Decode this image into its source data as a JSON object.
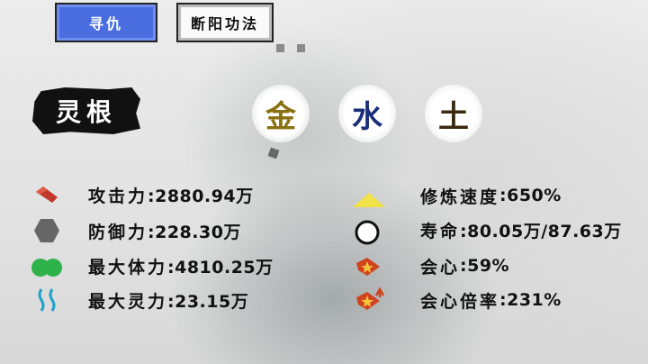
{
  "tabs": {
    "active_label": "寻仇",
    "inactive_label": "断阳功法"
  },
  "spirit_root": {
    "title": "灵根",
    "elements": [
      {
        "char": "金",
        "color": "#8a7010"
      },
      {
        "char": "水",
        "color": "#1a2e7a"
      },
      {
        "char": "土",
        "color": "#3a2a10"
      }
    ]
  },
  "stats_left": [
    {
      "icon": "red-gem-icon",
      "label": "攻击力",
      "value": ":2880.94万"
    },
    {
      "icon": "gray-shield-icon",
      "label": "防御力",
      "value": ":228.30万"
    },
    {
      "icon": "green-heart-icon",
      "label": "最大体力",
      "value": ":4810.25万"
    },
    {
      "icon": "blue-spirit-wave-icon",
      "label": "最大灵力",
      "value": ":23.15万"
    }
  ],
  "stats_right": [
    {
      "icon": "yellow-triangle-icon",
      "label": "修炼速度",
      "value": ":650%"
    },
    {
      "icon": "white-circle-icon",
      "label": "寿命",
      "value": ":80.05万/87.63万"
    },
    {
      "icon": "crit-star-icon",
      "label": "会心",
      "value": ":59%"
    },
    {
      "icon": "crit-multiplier-icon",
      "label": "会心倍率",
      "value": ":231%"
    }
  ]
}
